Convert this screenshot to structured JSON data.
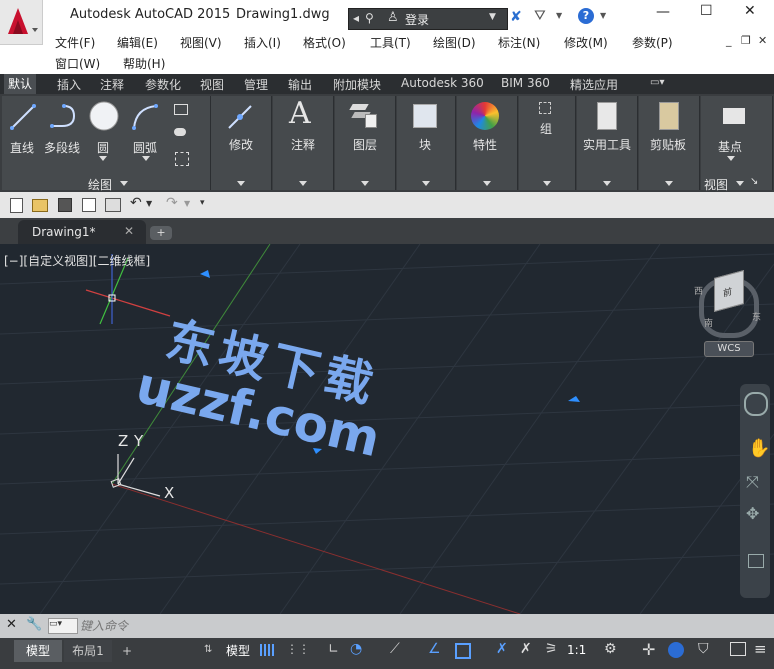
{
  "app_title": "Autodesk AutoCAD 2015",
  "doc_title": "Drawing1.dwg",
  "search": {
    "login_label": "登录"
  },
  "window_controls": {
    "minimize": "—",
    "maximize": "☐",
    "close": "✕"
  },
  "menu": [
    "文件(F)",
    "编辑(E)",
    "视图(V)",
    "插入(I)",
    "格式(O)",
    "工具(T)",
    "绘图(D)",
    "标注(N)",
    "修改(M)",
    "参数(P)",
    "窗口(W)",
    "帮助(H)"
  ],
  "ribbon_tabs": [
    "默认",
    "插入",
    "注释",
    "参数化",
    "视图",
    "管理",
    "输出",
    "附加模块",
    "Autodesk 360",
    "BIM 360",
    "精选应用"
  ],
  "ribbon": {
    "draw_tools": [
      "直线",
      "多段线",
      "圆",
      "圆弧"
    ],
    "draw_panel_label": "绘图",
    "modify": "修改",
    "annotate": "注释",
    "layer": "图层",
    "block": "块",
    "properties": "特性",
    "group": "组",
    "utilities": "实用工具",
    "clipboard": "剪贴板",
    "basepoint": "基点",
    "view_panel_label": "视图"
  },
  "doc_tab": {
    "label": "Drawing1*"
  },
  "viewport_label": "[−][自定义视图][二维线框]",
  "watermark": {
    "line1": "东坡下载",
    "line2": "uzzf.com"
  },
  "viewcube": {
    "top_face": "前",
    "west": "西",
    "south": "南",
    "east": "东",
    "wcs": "WCS"
  },
  "ucs_labels": {
    "z": "Z",
    "y": "Y",
    "x": "X"
  },
  "command": {
    "placeholder": "键入命令"
  },
  "layout_tabs": [
    "模型",
    "布局1"
  ],
  "status": {
    "model": "模型",
    "scale": "1:1"
  },
  "colors": {
    "canvas_bg": "#212830",
    "ribbon_bg": "#3a3d40",
    "watermark": "#7aa8ee"
  }
}
